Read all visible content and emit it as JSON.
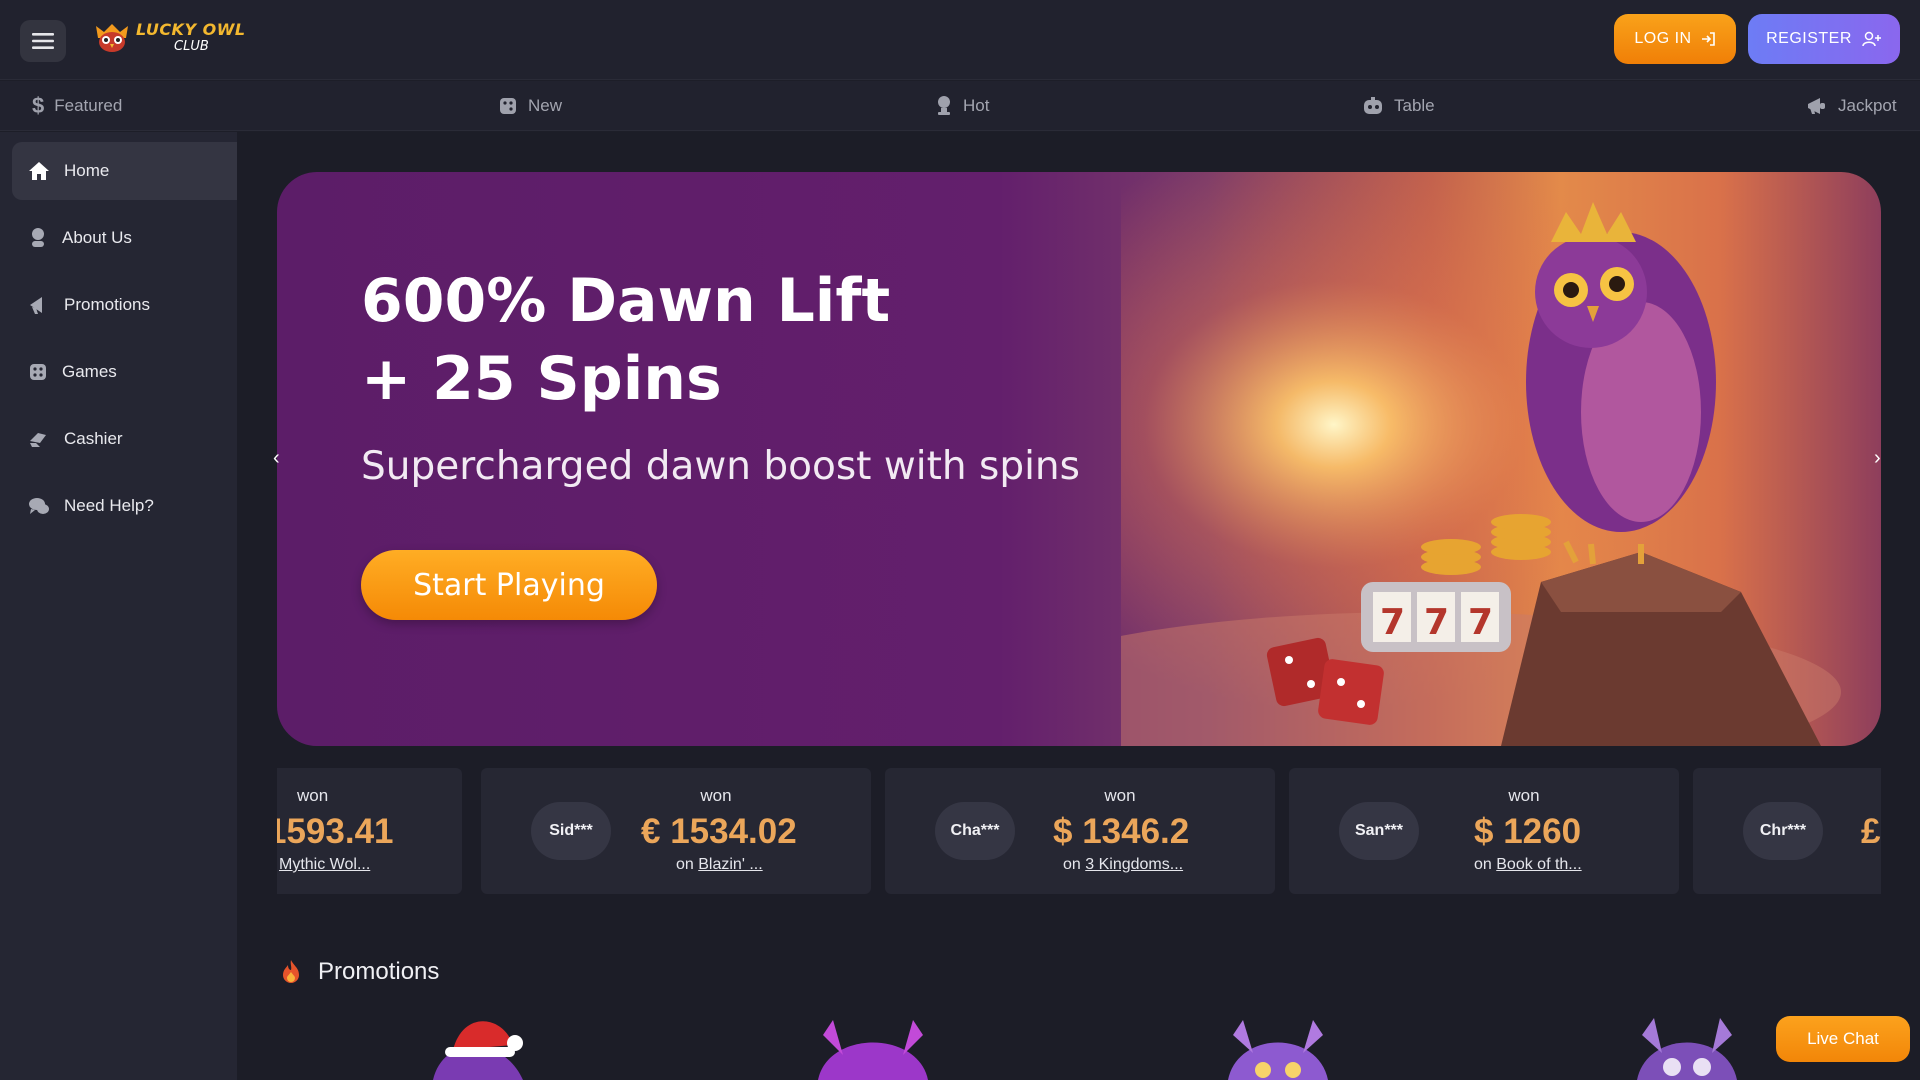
{
  "header": {
    "menu_icon": "hamburger-icon",
    "logo": {
      "main": "LUCKY OWL",
      "sub": "CLUB"
    },
    "login_label": "LOG IN",
    "register_label": "REGISTER"
  },
  "categories": [
    {
      "label": "Featured",
      "icon": "dollar-icon"
    },
    {
      "label": "New",
      "icon": "dice-icon"
    },
    {
      "label": "Hot",
      "icon": "trophy-icon"
    },
    {
      "label": "Table",
      "icon": "cards-icon"
    },
    {
      "label": "Jackpot",
      "icon": "megaphone-icon"
    }
  ],
  "sidebar": {
    "items": [
      {
        "label": "Home",
        "icon": "home-icon",
        "active": true
      },
      {
        "label": "About Us",
        "icon": "person-icon"
      },
      {
        "label": "Promotions",
        "icon": "megaphone-icon"
      },
      {
        "label": "Games",
        "icon": "dice-icon"
      },
      {
        "label": "Cashier",
        "icon": "cash-icon"
      },
      {
        "label": "Need Help?",
        "icon": "chat-icon"
      }
    ]
  },
  "hero": {
    "title_line1": "600% Dawn Lift",
    "title_line2": "+ 25 Spins",
    "subtitle": "Supercharged dawn boost with spins",
    "cta": "Start Playing"
  },
  "winners": [
    {
      "user": "",
      "won": "won",
      "amount": "1593.41",
      "on": "",
      "game": "Mythic Wol..."
    },
    {
      "user": "Sid***",
      "won": "won",
      "amount": "€ 1534.02",
      "on": "on",
      "game": "Blazin' ..."
    },
    {
      "user": "Cha***",
      "won": "won",
      "amount": "$ 1346.2",
      "on": "on",
      "game": "3 Kingdoms..."
    },
    {
      "user": "San***",
      "won": "won",
      "amount": "$ 1260",
      "on": "on",
      "game": "Book of th..."
    },
    {
      "user": "Chr***",
      "won": "",
      "amount": "£",
      "on": "",
      "game": ""
    }
  ],
  "promotions": {
    "title": "Promotions",
    "icon": "fire-icon"
  },
  "live_chat": "Live Chat",
  "colors": {
    "accent_orange": "#f59012",
    "accent_purple": "#7c70f2",
    "amount": "#eba65a",
    "bg": "#1c1d27"
  }
}
